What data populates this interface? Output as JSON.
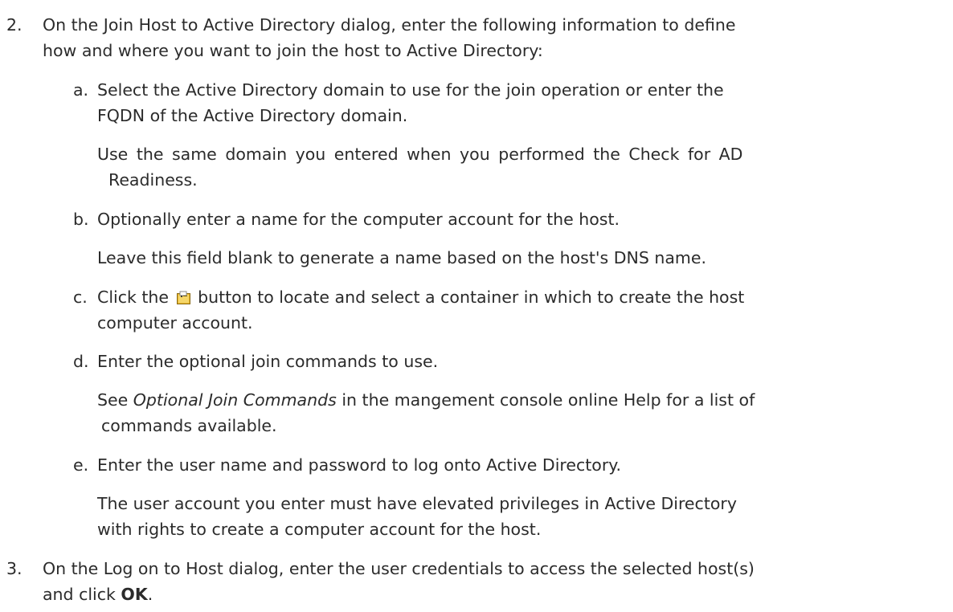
{
  "step2": {
    "number": "2.",
    "line1": "On the Join Host to Active Directory dialog, enter the following information to define",
    "line2": "how and where you want to join the host to Active Directory:"
  },
  "substeps": {
    "a": {
      "label": "a.",
      "line1": "Select the Active Directory domain to use for the join operation or enter the",
      "line2": "FQDN of the Active Directory domain.",
      "note1": "Use the same domain you entered when you performed the Check for AD",
      "note2": "Readiness."
    },
    "b": {
      "label": "b.",
      "line1": "Optionally enter a name for the computer account for the host.",
      "note1": "Leave this field blank to generate a name based on the host's DNS name."
    },
    "c": {
      "label": "c.",
      "line1_before": "Click the",
      "line1_after": "button to locate and select a container in which to create the host",
      "line2": "computer account.",
      "icon": "browse-container-icon"
    },
    "d": {
      "label": "d.",
      "line1": "Enter the optional join commands to use.",
      "note_italic": "Optional Join Commands",
      "note_before": "See",
      "note_after": "in the mangement console online Help for a list of",
      "note2": "commands available."
    },
    "e": {
      "label": "e.",
      "line1": "Enter the user name and password to log onto Active Directory.",
      "note1": "The user account you enter must have elevated privileges in Active Directory",
      "note2": "with rights to create a computer account for the host."
    }
  },
  "step3": {
    "number": "3.",
    "line1": "On the Log on to Host dialog, enter the user credentials to access the selected host(s)",
    "line2_before": "and click",
    "line2_bold": "OK",
    "line2_after": "."
  },
  "colors": {
    "text": "#2b2b2b",
    "icon_yellow": "#e8b62c",
    "icon_dark": "#8a6a14"
  }
}
